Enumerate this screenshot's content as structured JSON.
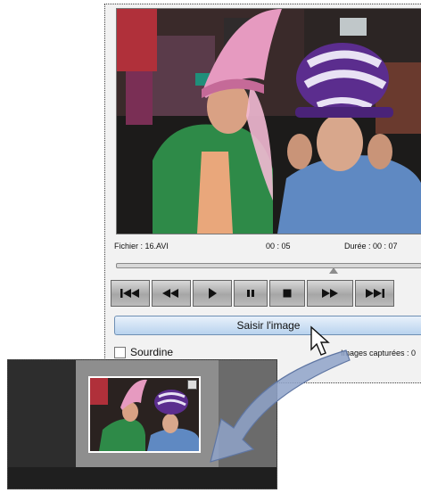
{
  "player": {
    "file_label": "Fichier : 16.AVI",
    "current_time": "00 : 05",
    "duration_label": "Durée :  00 : 07",
    "grab_button_label": "Saisir l'image",
    "mute_label": "Sourdine",
    "captured_label": "Images capturées : 0",
    "scrub_position_fraction": 0.71,
    "accent_color": "#b9d3ee"
  },
  "transport": {
    "buttons": [
      "skip-to-start-icon",
      "rewind-icon",
      "play-icon",
      "pause-icon",
      "stop-icon",
      "fast-forward-icon",
      "skip-to-end-icon"
    ]
  },
  "timeline": {
    "thumbnail_icon": "resize-corner-icon"
  },
  "overlay": {
    "pointer_icon": "mouse-pointer-icon",
    "arrow_icon": "curved-arrow-icon"
  }
}
